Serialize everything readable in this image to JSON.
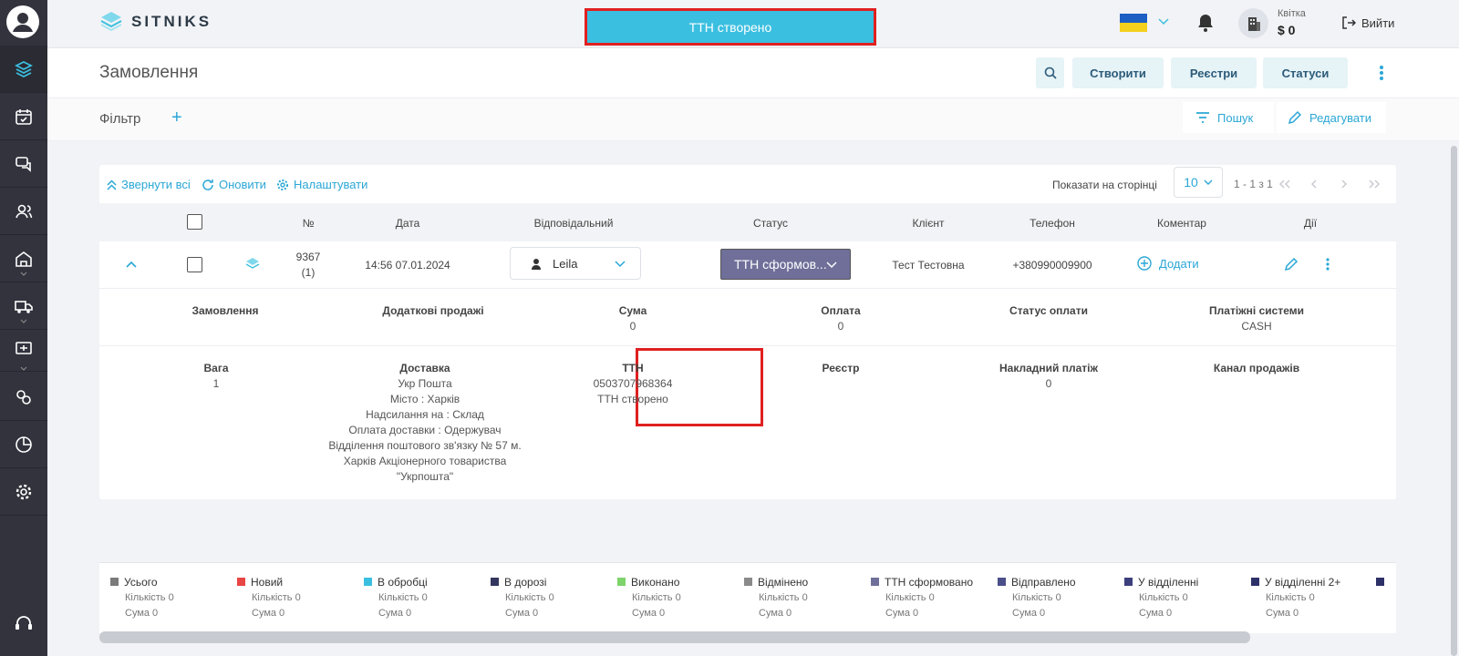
{
  "brand": {
    "name": "SITNIKS"
  },
  "toast": {
    "message": "ТТН створено"
  },
  "account": {
    "name": "Квітка",
    "balance": "$ 0"
  },
  "header": {
    "logout": "Вийти",
    "title": "Замовлення",
    "buttons": {
      "create": "Створити",
      "registers": "Реєстри",
      "statuses": "Статуси"
    }
  },
  "filter": {
    "title": "Фільтр",
    "add": "+",
    "search": "Пошук",
    "edit": "Редагувати"
  },
  "toolbar": {
    "collapse_all": "Звернути всі",
    "refresh": "Оновити",
    "settings": "Налаштувати",
    "per_page_label": "Показати на сторінці",
    "per_page": "10",
    "range": "1 - 1 з 1"
  },
  "table": {
    "columns": {
      "number": "№",
      "date": "Дата",
      "responsible": "Відповідальний",
      "status": "Статус",
      "client": "Клієнт",
      "phone": "Телефон",
      "comment": "Коментар",
      "actions": "Дії"
    }
  },
  "order": {
    "number": "9367",
    "count": "(1)",
    "date": "14:56 07.01.2024",
    "responsible": "Leila",
    "status": "ТТН сформов...",
    "client": "Тест Тестовна",
    "phone": "+380990009900",
    "comment_add": "Додати"
  },
  "details": {
    "order_label": "Замовлення",
    "extra_sales_label": "Додаткові продажі",
    "sum_label": "Сума",
    "sum": "0",
    "payment_label": "Оплата",
    "payment": "0",
    "payment_status_label": "Статус оплати",
    "payment_systems_label": "Платіжні системи",
    "payment_systems": "CASH",
    "weight_label": "Вага",
    "weight": "1",
    "delivery_label": "Доставка",
    "delivery_lines": [
      "Укр Пошта",
      "Місто : Харків",
      "Надсилання на : Склад",
      "Оплата доставки : Одержувач",
      "Відділення поштового зв'язку № 57 м.",
      "Харків Акціонерного товариства",
      "\"Укрпошта\""
    ],
    "ttn_label": "ТТН",
    "ttn": "0503707968364",
    "ttn_status": "ТТН створено",
    "register_label": "Реєстр",
    "cod_label": "Накладний платіж",
    "cod": "0",
    "channel_label": "Канал продажів"
  },
  "summary": {
    "qty_label": "Кількість 0",
    "sum_label": "Сума 0",
    "items": [
      {
        "label": "Усього",
        "color": "#7a7a7a"
      },
      {
        "label": "Новий",
        "color": "#e84545"
      },
      {
        "label": "В обробці",
        "color": "#3bbfe0"
      },
      {
        "label": "В дорозі",
        "color": "#33365e"
      },
      {
        "label": "Виконано",
        "color": "#7ed36a"
      },
      {
        "label": "Відмінено",
        "color": "#8a8a8a"
      },
      {
        "label": "ТТН сформовано",
        "color": "#6f6f9a"
      },
      {
        "label": "Відправлено",
        "color": "#4a4f8a"
      },
      {
        "label": "У відділенні",
        "color": "#3c3f7c"
      },
      {
        "label": "У відділенні 2+",
        "color": "#2e3168"
      }
    ]
  }
}
